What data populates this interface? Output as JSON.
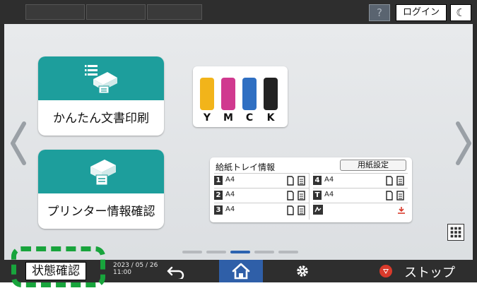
{
  "header": {
    "help_label": "?",
    "login_label": "ログイン",
    "sleep_label": "☾"
  },
  "apps": [
    {
      "label": "かんたん文書印刷",
      "icon": "document-printer-icon"
    },
    {
      "label": "プリンター情報確認",
      "icon": "printer-info-icon"
    }
  ],
  "toner": {
    "cartridges": [
      {
        "label": "Y",
        "color": "#f2b41a"
      },
      {
        "label": "M",
        "color": "#d0398f"
      },
      {
        "label": "C",
        "color": "#2f6fc2"
      },
      {
        "label": "K",
        "color": "#222222"
      }
    ]
  },
  "tray": {
    "title": "給紙トレイ情報",
    "paper_settings_label": "用紙設定",
    "rows": [
      {
        "num": "1",
        "size": "A4"
      },
      {
        "num": "2",
        "size": "A4"
      },
      {
        "num": "3",
        "size": "A4"
      },
      {
        "num": "4",
        "size": "A4"
      },
      {
        "num": "T",
        "size": "A4"
      },
      {
        "num": "",
        "size": ""
      }
    ]
  },
  "pagination": {
    "count": 5,
    "active_index": 2
  },
  "footer": {
    "status_label": "状態確認",
    "date": "2023 / 05 / 26",
    "time": "11:00",
    "stop_label": "ストップ"
  },
  "colors": {
    "accent_teal": "#1d9e9c",
    "home_blue": "#2f5fa8",
    "highlight_green": "#18a43c",
    "stop_red": "#d93a2b"
  }
}
